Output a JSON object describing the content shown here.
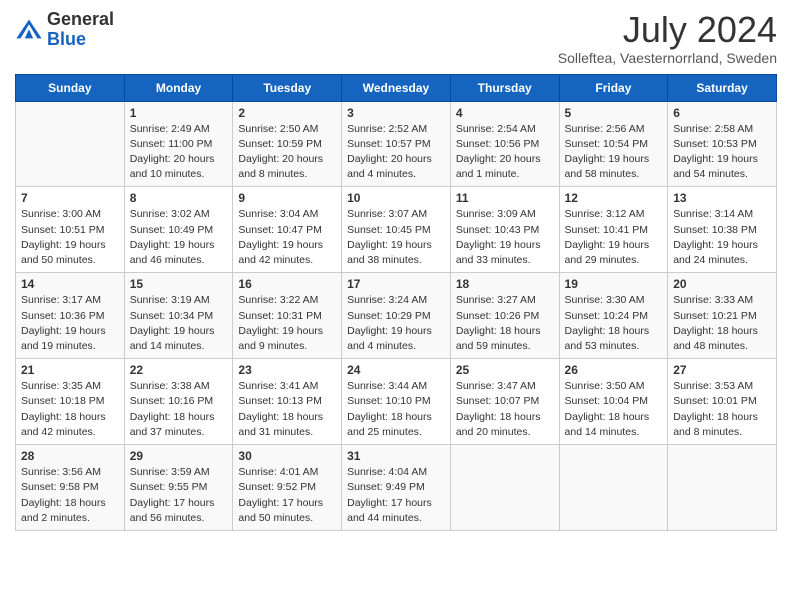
{
  "header": {
    "logo_general": "General",
    "logo_blue": "Blue",
    "month_title": "July 2024",
    "location": "Solleftea, Vaesternorrland, Sweden"
  },
  "days_of_week": [
    "Sunday",
    "Monday",
    "Tuesday",
    "Wednesday",
    "Thursday",
    "Friday",
    "Saturday"
  ],
  "weeks": [
    [
      {
        "day": "",
        "info": ""
      },
      {
        "day": "1",
        "info": "Sunrise: 2:49 AM\nSunset: 11:00 PM\nDaylight: 20 hours\nand 10 minutes."
      },
      {
        "day": "2",
        "info": "Sunrise: 2:50 AM\nSunset: 10:59 PM\nDaylight: 20 hours\nand 8 minutes."
      },
      {
        "day": "3",
        "info": "Sunrise: 2:52 AM\nSunset: 10:57 PM\nDaylight: 20 hours\nand 4 minutes."
      },
      {
        "day": "4",
        "info": "Sunrise: 2:54 AM\nSunset: 10:56 PM\nDaylight: 20 hours\nand 1 minute."
      },
      {
        "day": "5",
        "info": "Sunrise: 2:56 AM\nSunset: 10:54 PM\nDaylight: 19 hours\nand 58 minutes."
      },
      {
        "day": "6",
        "info": "Sunrise: 2:58 AM\nSunset: 10:53 PM\nDaylight: 19 hours\nand 54 minutes."
      }
    ],
    [
      {
        "day": "7",
        "info": "Sunrise: 3:00 AM\nSunset: 10:51 PM\nDaylight: 19 hours\nand 50 minutes."
      },
      {
        "day": "8",
        "info": "Sunrise: 3:02 AM\nSunset: 10:49 PM\nDaylight: 19 hours\nand 46 minutes."
      },
      {
        "day": "9",
        "info": "Sunrise: 3:04 AM\nSunset: 10:47 PM\nDaylight: 19 hours\nand 42 minutes."
      },
      {
        "day": "10",
        "info": "Sunrise: 3:07 AM\nSunset: 10:45 PM\nDaylight: 19 hours\nand 38 minutes."
      },
      {
        "day": "11",
        "info": "Sunrise: 3:09 AM\nSunset: 10:43 PM\nDaylight: 19 hours\nand 33 minutes."
      },
      {
        "day": "12",
        "info": "Sunrise: 3:12 AM\nSunset: 10:41 PM\nDaylight: 19 hours\nand 29 minutes."
      },
      {
        "day": "13",
        "info": "Sunrise: 3:14 AM\nSunset: 10:38 PM\nDaylight: 19 hours\nand 24 minutes."
      }
    ],
    [
      {
        "day": "14",
        "info": "Sunrise: 3:17 AM\nSunset: 10:36 PM\nDaylight: 19 hours\nand 19 minutes."
      },
      {
        "day": "15",
        "info": "Sunrise: 3:19 AM\nSunset: 10:34 PM\nDaylight: 19 hours\nand 14 minutes."
      },
      {
        "day": "16",
        "info": "Sunrise: 3:22 AM\nSunset: 10:31 PM\nDaylight: 19 hours\nand 9 minutes."
      },
      {
        "day": "17",
        "info": "Sunrise: 3:24 AM\nSunset: 10:29 PM\nDaylight: 19 hours\nand 4 minutes."
      },
      {
        "day": "18",
        "info": "Sunrise: 3:27 AM\nSunset: 10:26 PM\nDaylight: 18 hours\nand 59 minutes."
      },
      {
        "day": "19",
        "info": "Sunrise: 3:30 AM\nSunset: 10:24 PM\nDaylight: 18 hours\nand 53 minutes."
      },
      {
        "day": "20",
        "info": "Sunrise: 3:33 AM\nSunset: 10:21 PM\nDaylight: 18 hours\nand 48 minutes."
      }
    ],
    [
      {
        "day": "21",
        "info": "Sunrise: 3:35 AM\nSunset: 10:18 PM\nDaylight: 18 hours\nand 42 minutes."
      },
      {
        "day": "22",
        "info": "Sunrise: 3:38 AM\nSunset: 10:16 PM\nDaylight: 18 hours\nand 37 minutes."
      },
      {
        "day": "23",
        "info": "Sunrise: 3:41 AM\nSunset: 10:13 PM\nDaylight: 18 hours\nand 31 minutes."
      },
      {
        "day": "24",
        "info": "Sunrise: 3:44 AM\nSunset: 10:10 PM\nDaylight: 18 hours\nand 25 minutes."
      },
      {
        "day": "25",
        "info": "Sunrise: 3:47 AM\nSunset: 10:07 PM\nDaylight: 18 hours\nand 20 minutes."
      },
      {
        "day": "26",
        "info": "Sunrise: 3:50 AM\nSunset: 10:04 PM\nDaylight: 18 hours\nand 14 minutes."
      },
      {
        "day": "27",
        "info": "Sunrise: 3:53 AM\nSunset: 10:01 PM\nDaylight: 18 hours\nand 8 minutes."
      }
    ],
    [
      {
        "day": "28",
        "info": "Sunrise: 3:56 AM\nSunset: 9:58 PM\nDaylight: 18 hours\nand 2 minutes."
      },
      {
        "day": "29",
        "info": "Sunrise: 3:59 AM\nSunset: 9:55 PM\nDaylight: 17 hours\nand 56 minutes."
      },
      {
        "day": "30",
        "info": "Sunrise: 4:01 AM\nSunset: 9:52 PM\nDaylight: 17 hours\nand 50 minutes."
      },
      {
        "day": "31",
        "info": "Sunrise: 4:04 AM\nSunset: 9:49 PM\nDaylight: 17 hours\nand 44 minutes."
      },
      {
        "day": "",
        "info": ""
      },
      {
        "day": "",
        "info": ""
      },
      {
        "day": "",
        "info": ""
      }
    ]
  ]
}
